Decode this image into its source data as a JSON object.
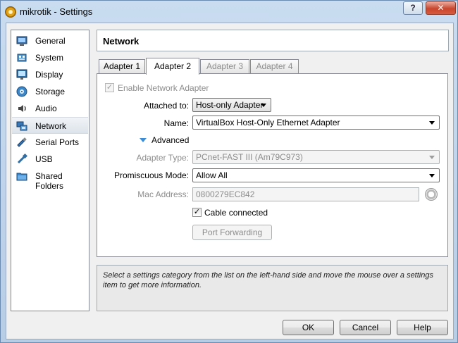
{
  "window": {
    "title": "mikrotik - Settings",
    "help_button": "?",
    "close_button": "✕"
  },
  "categories": [
    {
      "label": "General",
      "icon": "general-icon"
    },
    {
      "label": "System",
      "icon": "system-icon"
    },
    {
      "label": "Display",
      "icon": "display-icon"
    },
    {
      "label": "Storage",
      "icon": "storage-icon"
    },
    {
      "label": "Audio",
      "icon": "audio-icon"
    },
    {
      "label": "Network",
      "icon": "network-icon",
      "selected": true
    },
    {
      "label": "Serial Ports",
      "icon": "serial-ports-icon"
    },
    {
      "label": "USB",
      "icon": "usb-icon"
    },
    {
      "label": "Shared Folders",
      "icon": "shared-folders-icon"
    }
  ],
  "header": {
    "title": "Network"
  },
  "tabs": [
    {
      "label": "Adapter 1",
      "state": "normal"
    },
    {
      "label": "Adapter 2",
      "state": "active"
    },
    {
      "label": "Adapter 3",
      "state": "disabled"
    },
    {
      "label": "Adapter 4",
      "state": "disabled"
    }
  ],
  "form": {
    "enable_adapter": {
      "label": "Enable Network Adapter",
      "checked": true,
      "enabled": false
    },
    "attached_to": {
      "label": "Attached to:",
      "value": "Host-only Adapter"
    },
    "name": {
      "label": "Name:",
      "value": "VirtualBox Host-Only Ethernet Adapter"
    },
    "advanced": {
      "label": "Advanced",
      "expanded": true
    },
    "adapter_type": {
      "label": "Adapter Type:",
      "value": "PCnet-FAST III (Am79C973)",
      "enabled": false
    },
    "promiscuous_mode": {
      "label": "Promiscuous Mode:",
      "value": "Allow All"
    },
    "mac_address": {
      "label": "Mac Address:",
      "value": "0800279EC842",
      "enabled": false
    },
    "cable_connected": {
      "label": "Cable connected",
      "checked": true
    },
    "port_forwarding": {
      "label": "Port Forwarding",
      "enabled": false
    }
  },
  "info": {
    "text": "Select a settings category from the list on the left-hand side and move the mouse over a settings item to get more information."
  },
  "buttons": {
    "ok": "OK",
    "cancel": "Cancel",
    "help": "Help"
  },
  "colors": {
    "accent": "#3c8dd6",
    "window_frame": "#b9d1ea",
    "close_red": "#c8462e"
  }
}
